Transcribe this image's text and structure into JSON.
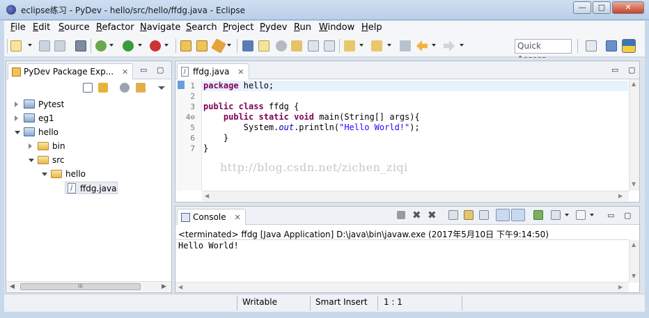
{
  "window": {
    "title": "eclipse练习 - PyDev - hello/src/hello/ffdg.java - Eclipse",
    "controls": {
      "minimize": "—",
      "maximize": "□",
      "close": "✕"
    }
  },
  "menu": [
    "File",
    "Edit",
    "Source",
    "Refactor",
    "Navigate",
    "Search",
    "Project",
    "Pydev",
    "Run",
    "Window",
    "Help"
  ],
  "toolbar": {
    "quick_access_placeholder": "Quick Access"
  },
  "package_explorer": {
    "title": "PyDev Package Exp...",
    "close": "✕",
    "min": "▭",
    "max": "▢",
    "tree": [
      {
        "label": "Pytest",
        "depth": 0,
        "state": "collapsed",
        "icon": "project-icon"
      },
      {
        "label": "eg1",
        "depth": 0,
        "state": "collapsed",
        "icon": "project-icon"
      },
      {
        "label": "hello",
        "depth": 0,
        "state": "expanded",
        "icon": "project-icon"
      },
      {
        "label": "bin",
        "depth": 1,
        "state": "collapsed",
        "icon": "folder-icon"
      },
      {
        "label": "src",
        "depth": 1,
        "state": "expanded",
        "icon": "folder-icon"
      },
      {
        "label": "hello",
        "depth": 2,
        "state": "expanded",
        "icon": "folder-icon"
      },
      {
        "label": "ffdg.java",
        "depth": 3,
        "state": "leaf",
        "icon": "java-file-icon",
        "selected": true
      }
    ],
    "scroll_thumb": "III"
  },
  "editor": {
    "tab_label": "ffdg.java",
    "close": "✕",
    "line_numbers": [
      "1",
      "2",
      "3",
      "4⊖",
      "5",
      "6",
      "7"
    ],
    "lines": [
      [
        {
          "t": "package",
          "c": "kw"
        },
        {
          "t": " hello;",
          "c": ""
        }
      ],
      [],
      [
        {
          "t": "public",
          "c": "kw"
        },
        {
          "t": " ",
          "c": ""
        },
        {
          "t": "class",
          "c": "kw"
        },
        {
          "t": " ffdg {",
          "c": ""
        }
      ],
      [
        {
          "t": "    ",
          "c": ""
        },
        {
          "t": "public",
          "c": "kw"
        },
        {
          "t": " ",
          "c": ""
        },
        {
          "t": "static",
          "c": "kw"
        },
        {
          "t": " ",
          "c": ""
        },
        {
          "t": "void",
          "c": "kw"
        },
        {
          "t": " main(String[] args){",
          "c": ""
        }
      ],
      [
        {
          "t": "        System.",
          "c": ""
        },
        {
          "t": "out",
          "c": "it"
        },
        {
          "t": ".println(",
          "c": ""
        },
        {
          "t": "\"Hello World!\"",
          "c": "str"
        },
        {
          "t": ");",
          "c": ""
        }
      ],
      [
        {
          "t": "    }",
          "c": ""
        }
      ],
      [
        {
          "t": "}",
          "c": ""
        }
      ]
    ],
    "watermark": "http://blog.csdn.net/zichen_ziqi"
  },
  "console": {
    "tab_label": "Console",
    "close": "✕",
    "info": "<terminated> ffdg [Java Application] D:\\java\\bin\\javaw.exe (2017年5月10日 下午9:14:50)",
    "output": "Hello World!"
  },
  "status": {
    "writable": "Writable",
    "insert_mode": "Smart Insert",
    "position": "1 : 1"
  },
  "colors": {
    "keyword": "#7f0055",
    "string": "#2a00ff",
    "static_field": "#0000c0"
  }
}
